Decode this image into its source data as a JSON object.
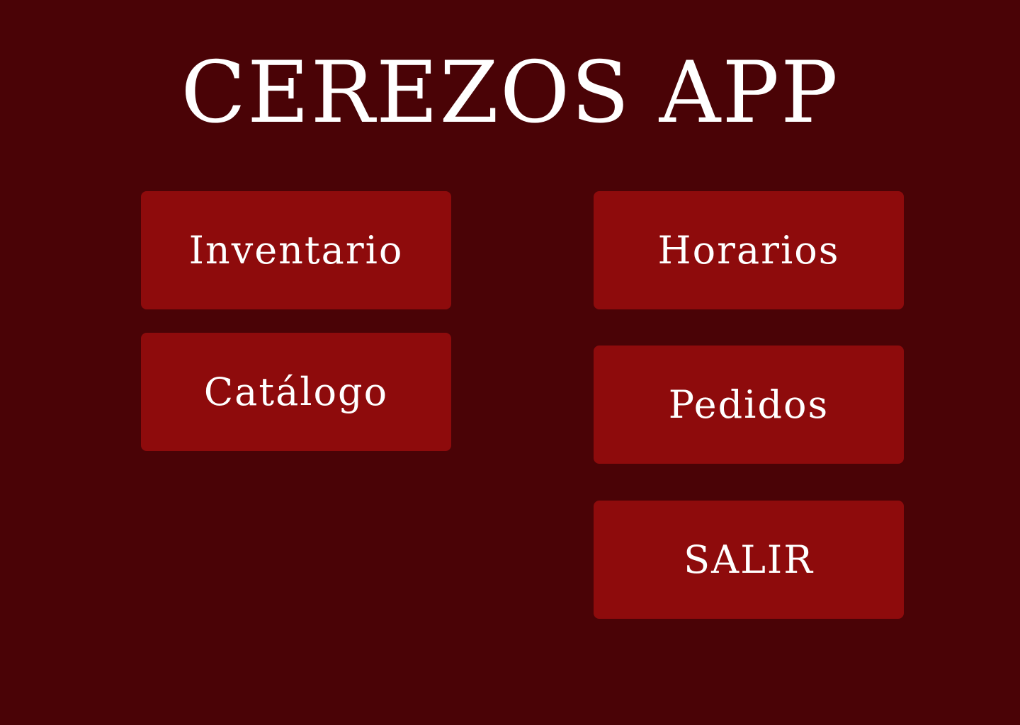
{
  "header": {
    "title": "CEREZOS APP"
  },
  "menu": {
    "inventario": "Inventario",
    "catalogo": "Catálogo",
    "horarios": "Horarios",
    "pedidos": "Pedidos",
    "salir": "SALIR"
  },
  "colors": {
    "background": "#4a0306",
    "button": "#8e0b0c",
    "text": "#ffffff"
  }
}
